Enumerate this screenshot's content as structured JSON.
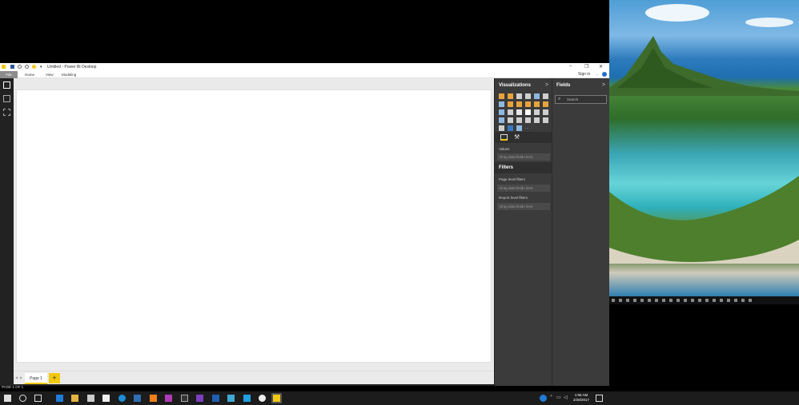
{
  "window": {
    "title": "Untitled - Power BI Desktop",
    "controls": {
      "minimize": "–",
      "maximize": "❐",
      "close": "✕"
    }
  },
  "ribbon": {
    "file_tab": "File",
    "tabs": [
      "Home",
      "View",
      "Modeling"
    ],
    "sign_in": "Sign in",
    "help_icon": "help-icon"
  },
  "left_nav": {
    "items": [
      {
        "name": "report-view",
        "icon": "bar-chart-icon"
      },
      {
        "name": "data-view",
        "icon": "table-icon"
      },
      {
        "name": "relationships-view",
        "icon": "relationships-icon"
      }
    ]
  },
  "pages": {
    "tabs": [
      "Page 1"
    ],
    "add_label": "+",
    "status": "PAGE 1 OF 1"
  },
  "visualizations": {
    "title": "Visualizations",
    "expand": ">",
    "wells": [
      {
        "label": "Values",
        "placeholder": "Drag data fields here"
      }
    ],
    "tools": [
      "fields-tool-icon",
      "format-paint-icon"
    ],
    "more": "..."
  },
  "filters": {
    "title": "Filters",
    "sections": [
      {
        "label": "Page level filters",
        "placeholder": "Drag data fields here"
      },
      {
        "label": "Report level filters",
        "placeholder": "Drag data fields here"
      }
    ]
  },
  "fields": {
    "title": "Fields",
    "expand": ">",
    "search_placeholder": "Search"
  },
  "taskbar": {
    "time": "1:55 AM",
    "date": "2/28/2017",
    "colors": {
      "accent": "#f2c811",
      "background": "#1c1c1c"
    }
  }
}
